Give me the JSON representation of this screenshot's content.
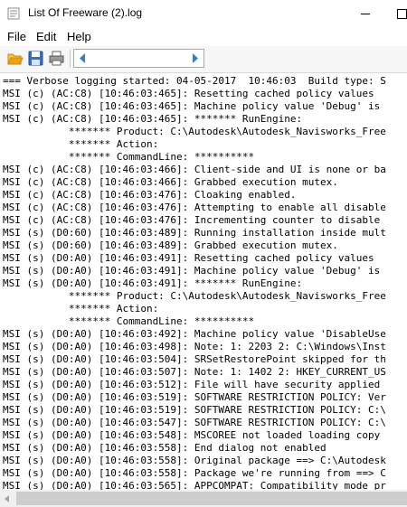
{
  "window": {
    "title": "List Of Freeware (2).log"
  },
  "menu": [
    "File",
    "Edit",
    "Help"
  ],
  "toolbar": {
    "icons": [
      "folder-open-icon",
      "save-icon",
      "print-icon",
      "arrow-left-icon",
      "arrow-right-icon"
    ],
    "colors": {
      "folder": "#e8a317",
      "save": "#3b6fb6",
      "nav_arrow": "#2f7fd6"
    }
  },
  "log": [
    "=== Verbose logging started: 04-05-2017  10:46:03  Build type: S",
    "MSI (c) (AC:C8) [10:46:03:465]: Resetting cached policy values",
    "MSI (c) (AC:C8) [10:46:03:465]: Machine policy value 'Debug' is",
    "MSI (c) (AC:C8) [10:46:03:465]: ******* RunEngine:",
    "           ******* Product: C:\\Autodesk\\Autodesk_Navisworks_Free",
    "           ******* Action:",
    "           ******* CommandLine: **********",
    "MSI (c) (AC:C8) [10:46:03:466]: Client-side and UI is none or ba",
    "MSI (c) (AC:C8) [10:46:03:466]: Grabbed execution mutex.",
    "MSI (c) (AC:C8) [10:46:03:476]: Cloaking enabled.",
    "MSI (c) (AC:C8) [10:46:03:476]: Attempting to enable all disable",
    "MSI (c) (AC:C8) [10:46:03:476]: Incrementing counter to disable",
    "MSI (s) (D0:60) [10:46:03:489]: Running installation inside mult",
    "MSI (s) (D0:60) [10:46:03:489]: Grabbed execution mutex.",
    "MSI (s) (D0:A0) [10:46:03:491]: Resetting cached policy values",
    "MSI (s) (D0:A0) [10:46:03:491]: Machine policy value 'Debug' is",
    "MSI (s) (D0:A0) [10:46:03:491]: ******* RunEngine:",
    "           ******* Product: C:\\Autodesk\\Autodesk_Navisworks_Free",
    "           ******* Action:",
    "           ******* CommandLine: **********",
    "MSI (s) (D0:A0) [10:46:03:492]: Machine policy value 'DisableUse",
    "MSI (s) (D0:A0) [10:46:03:498]: Note: 1: 2203 2: C:\\Windows\\Inst",
    "MSI (s) (D0:A0) [10:46:03:504]: SRSetRestorePoint skipped for th",
    "MSI (s) (D0:A0) [10:46:03:507]: Note: 1: 1402 2: HKEY_CURRENT_US",
    "MSI (s) (D0:A0) [10:46:03:512]: File will have security applied",
    "MSI (s) (D0:A0) [10:46:03:519]: SOFTWARE RESTRICTION POLICY: Ver",
    "MSI (s) (D0:A0) [10:46:03:519]: SOFTWARE RESTRICTION POLICY: C:\\",
    "MSI (s) (D0:A0) [10:46:03:547]: SOFTWARE RESTRICTION POLICY: C:\\",
    "MSI (s) (D0:A0) [10:46:03:548]: MSCOREE not loaded loading copy",
    "MSI (s) (D0:A0) [10:46:03:558]: End dialog not enabled",
    "MSI (s) (D0:A0) [10:46:03:558]: Original package ==> C:\\Autodesk",
    "MSI (s) (D0:A0) [10:46:03:558]: Package we're running from ==> C",
    "MSI (s) (D0:A0) [10:46:03:565]: APPCOMPAT: Compatibility mode pr"
  ]
}
